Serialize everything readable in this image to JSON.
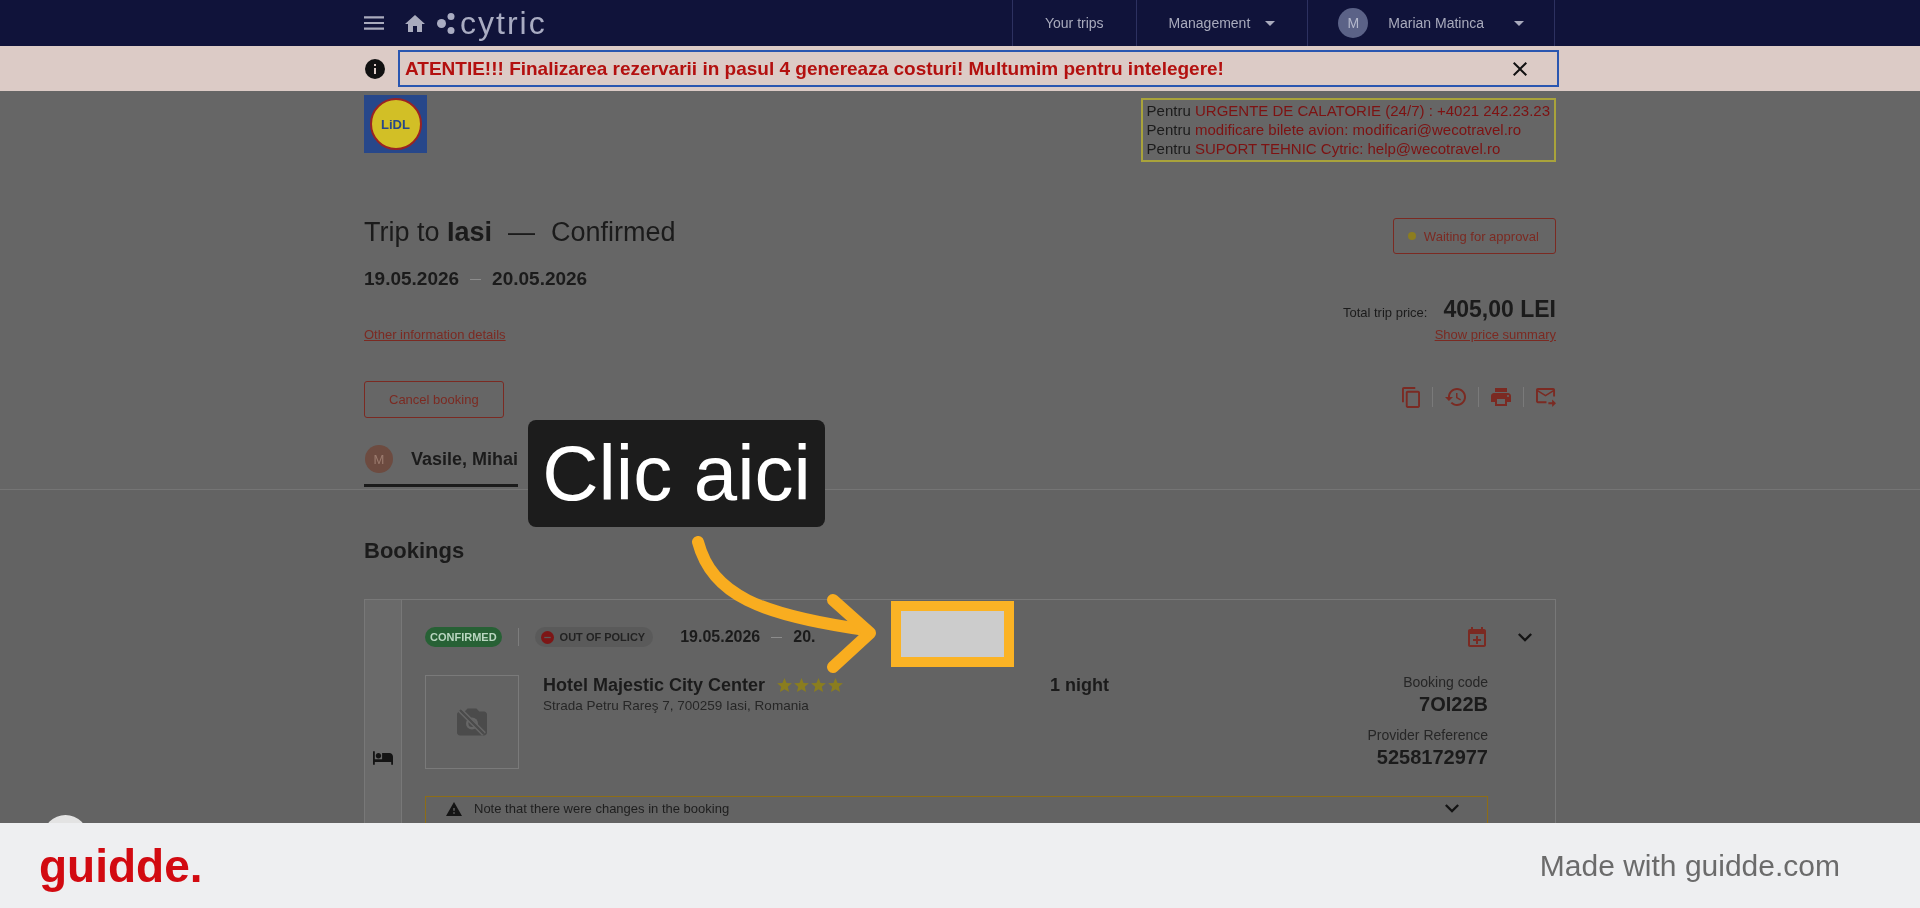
{
  "top_nav": {
    "brand": "cytric",
    "links": [
      {
        "kind": "link",
        "label": "Your trips"
      },
      {
        "kind": "dropdown",
        "label": "Management"
      }
    ],
    "user": {
      "initial": "M",
      "name": "Marian Matinca"
    }
  },
  "notice_banner": {
    "message": "ATENTIE!!! Finalizarea rezervarii in pasul 4 genereaza costuri! Multumim pentru intelegere!"
  },
  "company_logo": {
    "text": "LiDL"
  },
  "contact_box": {
    "lines": [
      {
        "prefix": "Pentru",
        "detail": "URGENTE DE CALATORIE (24/7) : +4021 242.23.23"
      },
      {
        "prefix": "Pentru",
        "detail": "modificare bilete avion: modificari@wecotravel.ro"
      },
      {
        "prefix": "Pentru",
        "detail": "SUPORT TEHNIC Cytric: help@wecotravel.ro"
      }
    ]
  },
  "trip": {
    "title": "Trip to **Iasi**",
    "title_separator": "—",
    "status": "Confirmed",
    "start_date": "19.05.2026",
    "end_date": "20.05.2026",
    "approval": "Waiting for approval",
    "other_info_link": "Other information details",
    "total_label": "Total trip price:",
    "total_price": "405,00 LEI",
    "price_summary_link": "Show price summary",
    "cancel_button": "Cancel booking"
  },
  "traveler_tabs": [
    {
      "initial": "M",
      "name": "Vasile, Mihai",
      "selected": true
    }
  ],
  "bookings": {
    "heading": "Bookings",
    "items": [
      {
        "status": "CONFIRMED",
        "policy": "OUT OF POLICY",
        "start_date": "19.05.2026",
        "end_date": "20.",
        "hotel_name": "Hotel Majestic City Center",
        "stars": 4,
        "address": "Strada Petru Rareş 7, 700259 Iasi, Romania",
        "duration": "1 night",
        "code_label": "Booking code",
        "code": "7OI22B",
        "provider_label": "Provider Reference",
        "provider_ref": "5258172977",
        "note": "Note that there were changes in the booking"
      }
    ]
  },
  "callout": {
    "text": "Clic aici"
  },
  "footer": {
    "brand": "guidde.",
    "credit": "Made with guidde.com"
  }
}
